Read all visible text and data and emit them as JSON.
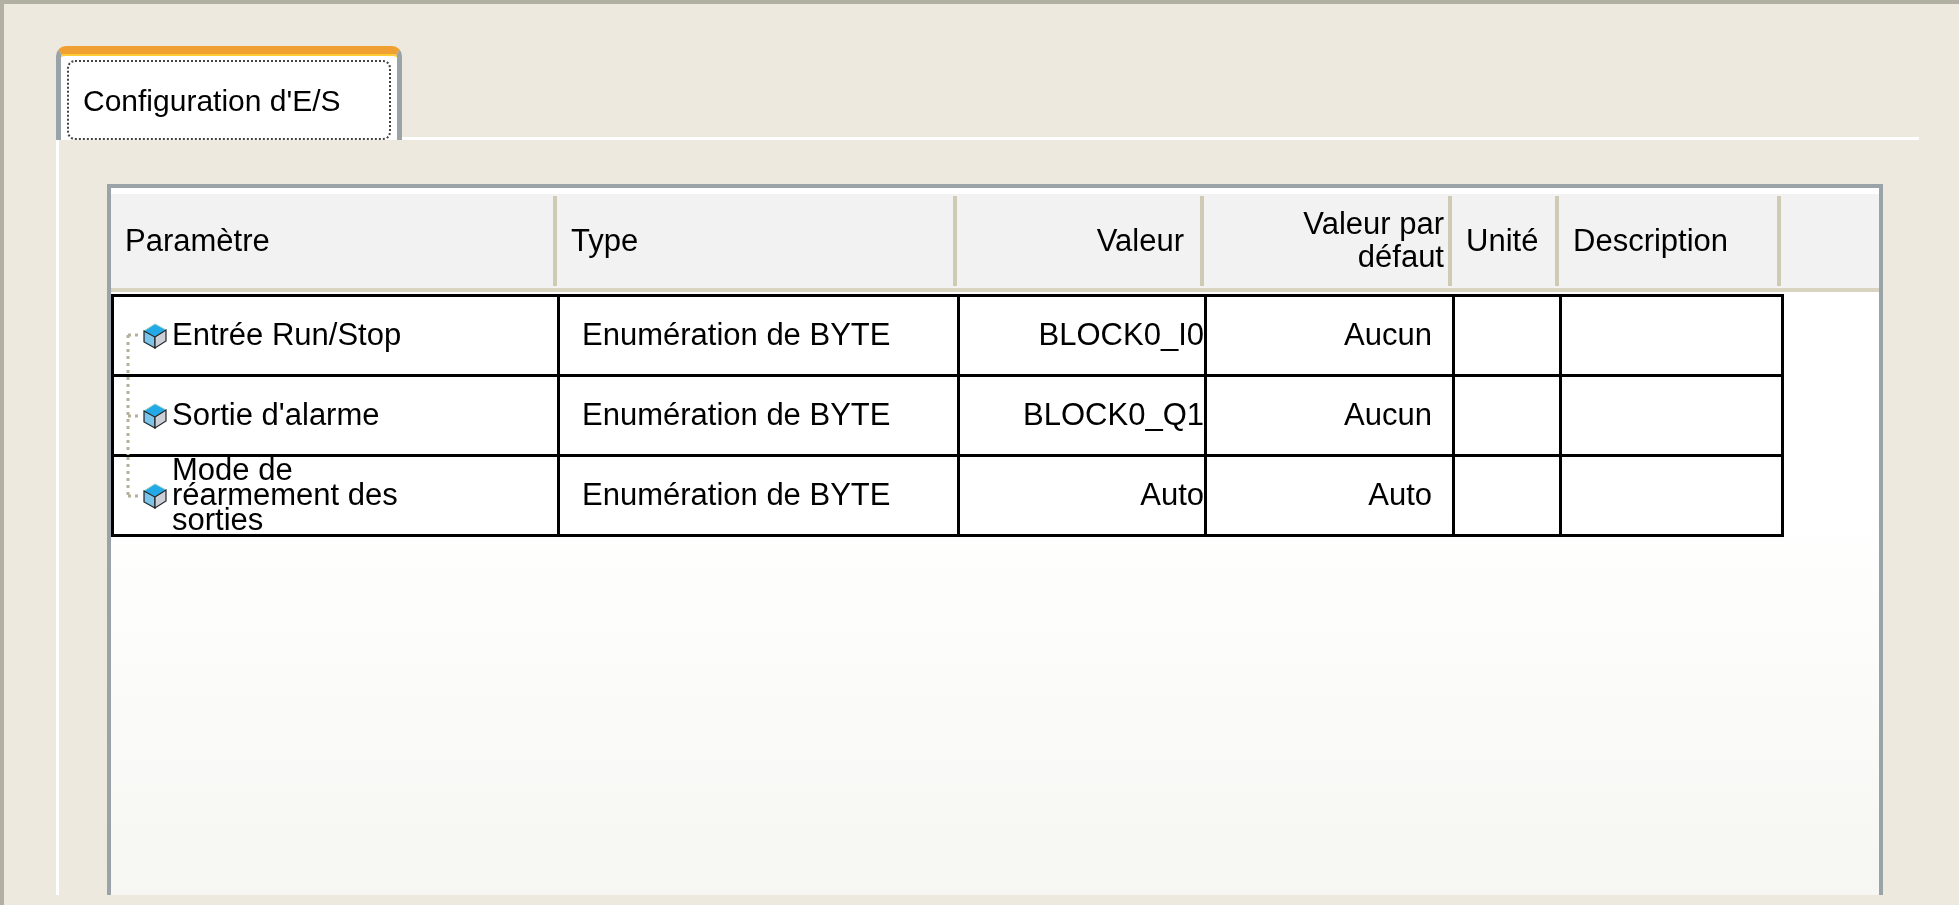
{
  "tabs": [
    {
      "label": "Configuration d'E/S",
      "selected": true
    }
  ],
  "table": {
    "columns": [
      "Paramètre",
      "Type",
      "Valeur",
      "Valeur par défaut",
      "Unité",
      "Description"
    ],
    "rows": [
      {
        "parameter": "Entrée Run/Stop",
        "type": "Enumération de BYTE",
        "value": "BLOCK0_I0",
        "default": "Aucun"
      },
      {
        "parameter": "Sortie d'alarme",
        "type": "Enumération de BYTE",
        "value": "BLOCK0_Q1",
        "default": "Aucun"
      },
      {
        "parameter": "Mode de réarmement des sorties",
        "type": "Enumération de BYTE",
        "value": "Auto",
        "default": "Auto"
      }
    ]
  }
}
